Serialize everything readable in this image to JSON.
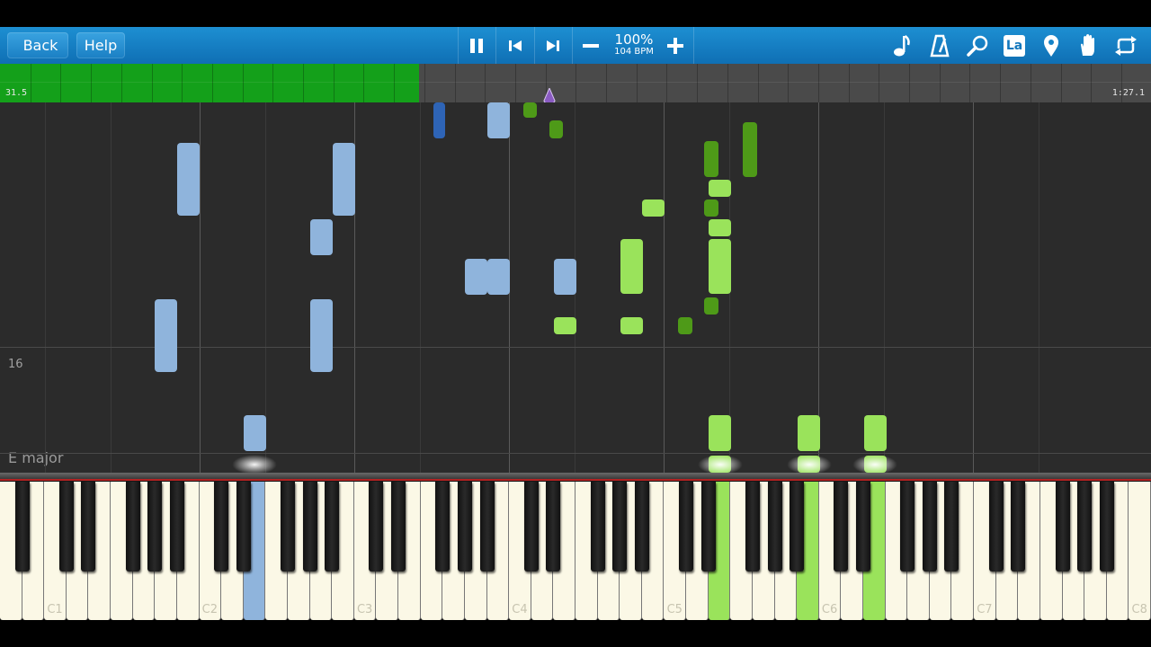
{
  "toolbar": {
    "back_label": "Back",
    "help_label": "Help",
    "speed_percent": "100%",
    "tempo_bpm": "104 BPM",
    "la_label": "La",
    "icons": [
      "pause-icon",
      "previous-icon",
      "next-icon",
      "minus-icon",
      "plus-icon",
      "music-note-icon",
      "metronome-icon",
      "zoom-icon",
      "la-icon",
      "location-pin-icon",
      "hand-icon",
      "loop-icon"
    ]
  },
  "progress": {
    "elapsed": "31.5",
    "total": "1:27.1",
    "fraction": 0.364,
    "playhead_fraction": 0.477
  },
  "roll": {
    "measure_number": "16",
    "key_signature": "E major"
  },
  "colors": {
    "left_hand": "#8fb4dc",
    "left_hand_dark": "#2e64b6",
    "right_hand": "#9ae35b",
    "right_hand_dark": "#4e9a18",
    "toolbar": "#1583c8",
    "progress": "#14a01a"
  },
  "keyboard": {
    "octave_labels": [
      "C1",
      "C2",
      "C3",
      "C4",
      "C5",
      "C6",
      "C7",
      "C8"
    ],
    "active_blue_keys": [
      "C2-region"
    ],
    "active_green_keys": [
      "C5-region",
      "C6-region",
      "C6-region-2"
    ]
  }
}
